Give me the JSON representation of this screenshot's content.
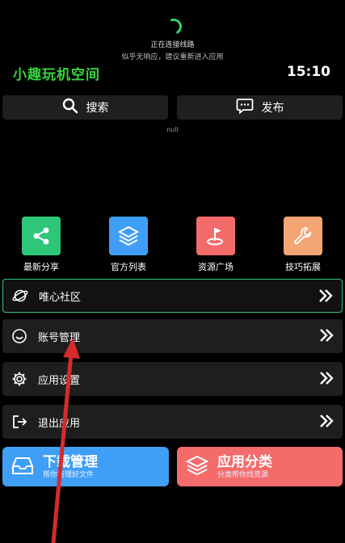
{
  "status": {
    "connecting_text": "正在连接线路",
    "hint_text": "似乎无响应，建议重新进入应用"
  },
  "header": {
    "app_title": "小趣玩机空间",
    "clock": "15:10"
  },
  "top_buttons": {
    "search_label": "搜索",
    "publish_label": "发布"
  },
  "null_text": "null",
  "tiles": [
    {
      "label": "最新分享",
      "color": "#2ec77a",
      "icon": "share-icon"
    },
    {
      "label": "官方列表",
      "color": "#3f9ef5",
      "icon": "layers-icon"
    },
    {
      "label": "资源广场",
      "color": "#f46b6b",
      "icon": "flag-icon"
    },
    {
      "label": "技巧拓展",
      "color": "#f4a574",
      "icon": "wrench-icon"
    }
  ],
  "rows": [
    {
      "label": "唯心社区",
      "icon": "planet-icon"
    },
    {
      "label": "账号管理",
      "icon": "smiley-icon"
    },
    {
      "label": "应用设置",
      "icon": "gear-icon"
    },
    {
      "label": "退出应用",
      "icon": "exit-icon"
    }
  ],
  "bottom_buttons": {
    "download_title": "下载管理",
    "download_sub": "帮你管理好文件",
    "category_title": "应用分类",
    "category_sub": "分类帮你找资源"
  },
  "colors": {
    "accent_green": "#38d43f",
    "tile_green": "#2ec77a",
    "tile_blue": "#3f9ef5",
    "tile_red": "#f46b6b",
    "tile_orange": "#f4a574",
    "annotation_arrow": "#d62b2b"
  }
}
